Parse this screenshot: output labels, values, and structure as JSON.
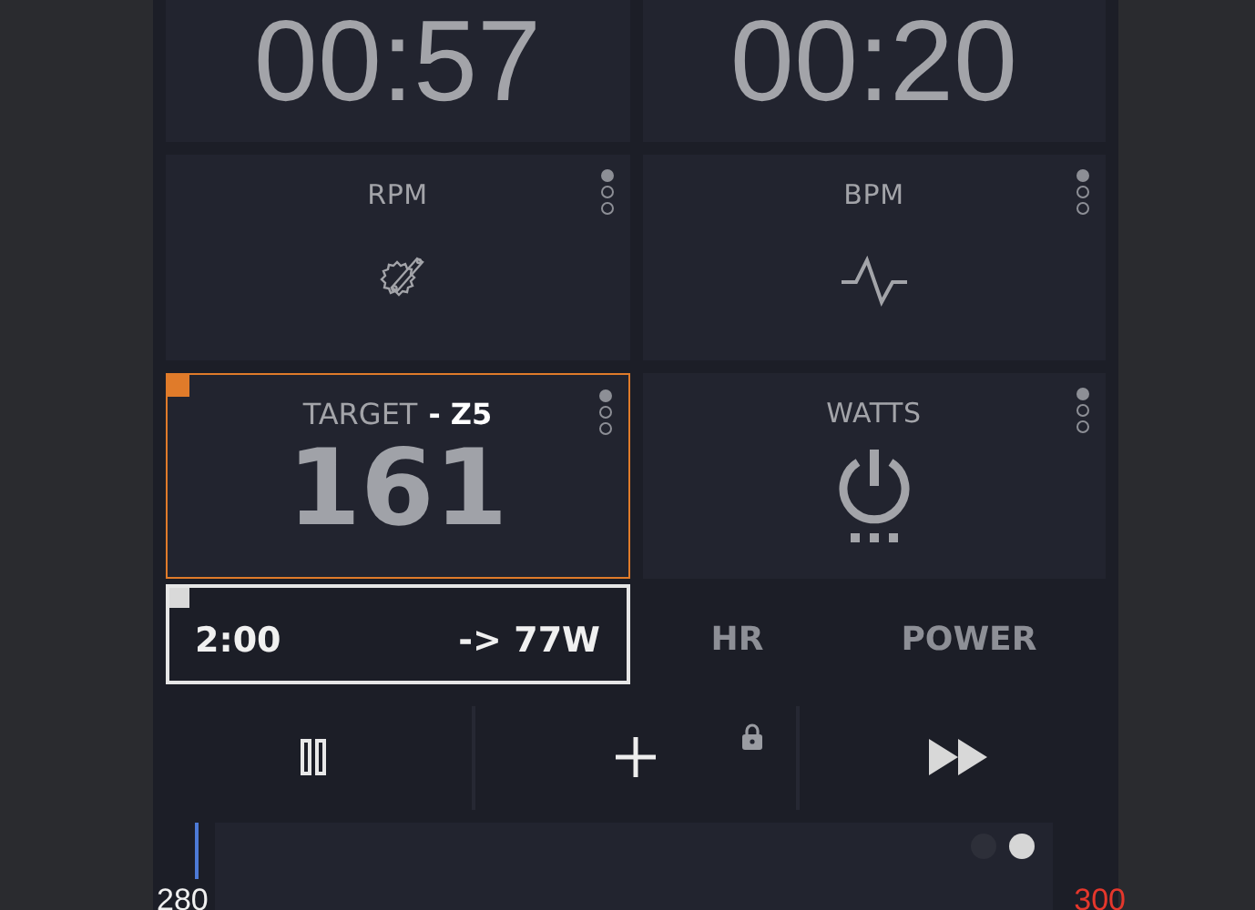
{
  "timers": [
    {
      "value": "00:57"
    },
    {
      "value": "00:20"
    }
  ],
  "tiles": [
    {
      "kind": "cadence",
      "label": "RPM",
      "pages": [
        {
          "selected": true
        },
        {
          "selected": false
        },
        {
          "selected": false
        }
      ]
    },
    {
      "kind": "heartrate",
      "label": "BPM",
      "pages": [
        {
          "selected": true
        },
        {
          "selected": false
        },
        {
          "selected": false
        }
      ]
    },
    {
      "kind": "target",
      "label": "TARGET",
      "zone": "- Z5",
      "value": "161",
      "selected": true,
      "pages": [
        {
          "selected": true
        },
        {
          "selected": false
        },
        {
          "selected": false
        }
      ]
    },
    {
      "kind": "power",
      "label": "WATTS",
      "selected": false,
      "pages": [
        {
          "selected": true
        },
        {
          "selected": false
        },
        {
          "selected": false
        }
      ]
    }
  ],
  "interval": {
    "time": "2:00",
    "target": "-> 77W",
    "selected": true
  },
  "tabs": [
    {
      "label": "HR"
    },
    {
      "label": "POWER"
    }
  ],
  "controls": [
    {
      "kind": "pause",
      "locked": false
    },
    {
      "kind": "add",
      "locked": true
    },
    {
      "kind": "forward",
      "locked": false
    }
  ],
  "chart_strip": {
    "scale_min": "280",
    "scale_max": "300",
    "pages": [
      {
        "selected": false
      },
      {
        "selected": true
      }
    ]
  }
}
